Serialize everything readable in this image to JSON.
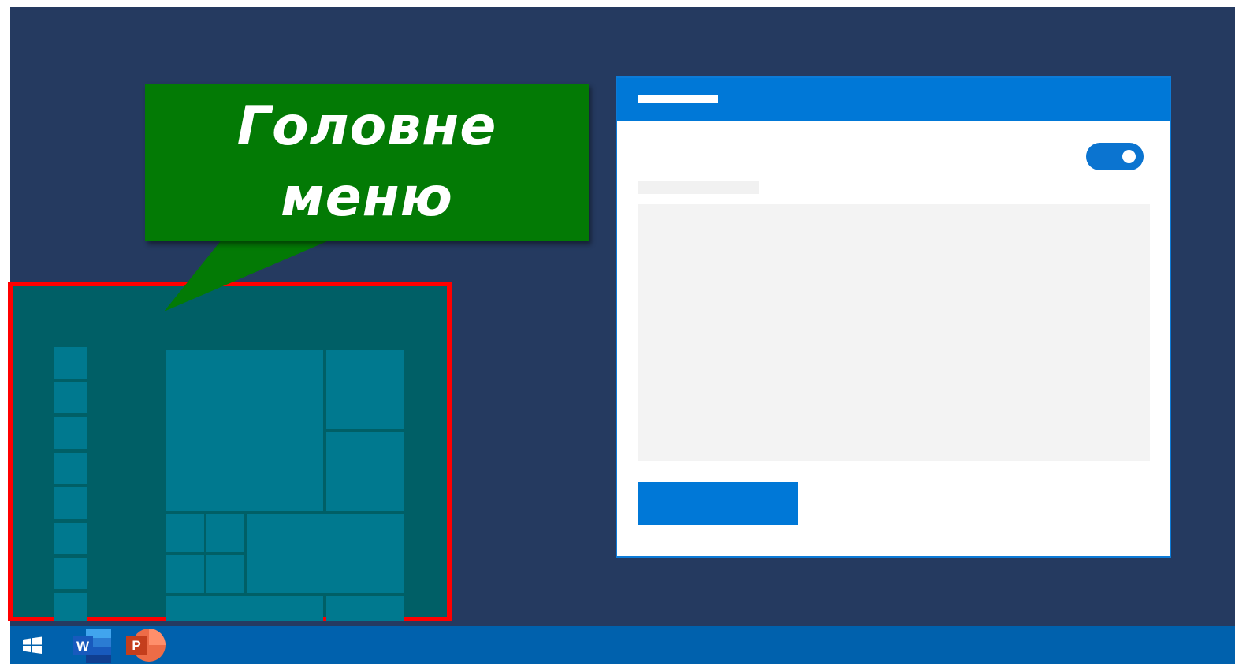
{
  "callout": {
    "text": "Головне\nменю",
    "color": "#037a05"
  },
  "start_menu": {
    "highlight_color": "#ff0000",
    "background": "#005f66",
    "tile_color": "#00798f"
  },
  "app_window": {
    "accent": "#0078d7",
    "toggle_state": "on"
  },
  "taskbar": {
    "background": "#0061ad",
    "items": [
      {
        "icon": "windows-start-icon"
      },
      {
        "icon": "word-icon",
        "label": "W"
      },
      {
        "icon": "powerpoint-icon",
        "label": "P"
      }
    ]
  }
}
